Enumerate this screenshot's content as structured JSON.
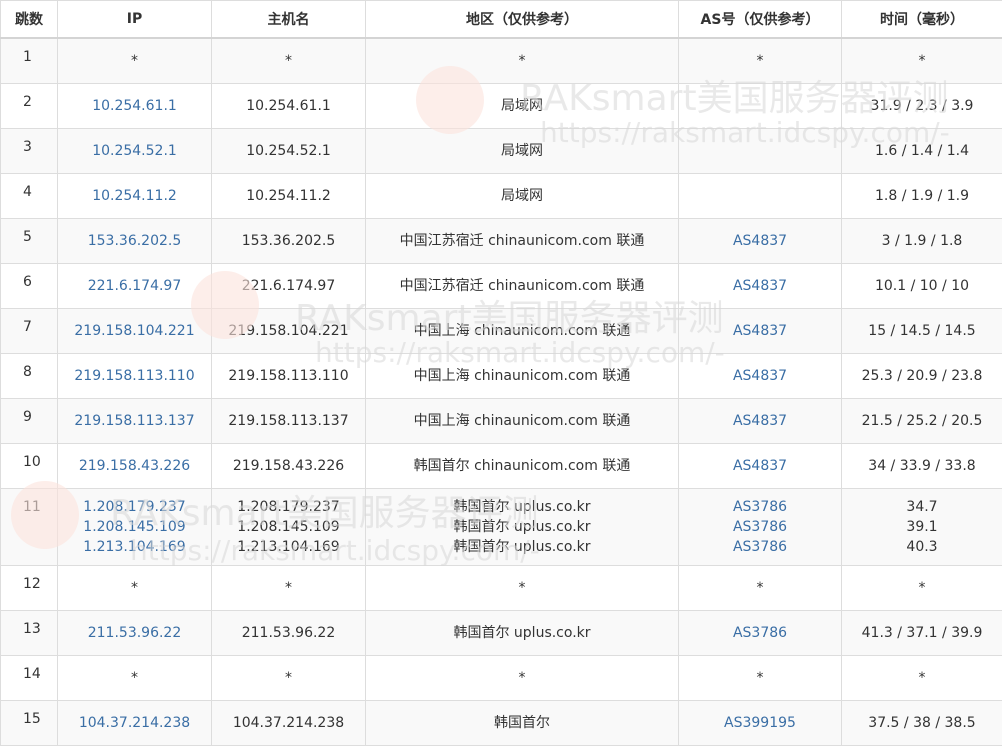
{
  "headers": {
    "hop": "跳数",
    "ip": "IP",
    "host": "主机名",
    "region": "地区（仅供参考）",
    "as": "AS号（仅供参考）",
    "time": "时间（毫秒）"
  },
  "rows": [
    {
      "hop": "1",
      "ip": "*",
      "host": "*",
      "region": "*",
      "as": "*",
      "time": "*"
    },
    {
      "hop": "2",
      "ip": "10.254.61.1",
      "host": "10.254.61.1",
      "region": "局域网",
      "as": "",
      "time": "31.9 / 2.3 / 3.9"
    },
    {
      "hop": "3",
      "ip": "10.254.52.1",
      "host": "10.254.52.1",
      "region": "局域网",
      "as": "",
      "time": "1.6 / 1.4 / 1.4"
    },
    {
      "hop": "4",
      "ip": "10.254.11.2",
      "host": "10.254.11.2",
      "region": "局域网",
      "as": "",
      "time": "1.8 / 1.9 / 1.9"
    },
    {
      "hop": "5",
      "ip": "153.36.202.5",
      "host": "153.36.202.5",
      "region": "中国江苏宿迁 chinaunicom.com 联通",
      "as": "AS4837",
      "time": "3 / 1.9 / 1.8"
    },
    {
      "hop": "6",
      "ip": "221.6.174.97",
      "host": "221.6.174.97",
      "region": "中国江苏宿迁 chinaunicom.com 联通",
      "as": "AS4837",
      "time": "10.1 / 10 / 10"
    },
    {
      "hop": "7",
      "ip": "219.158.104.221",
      "host": "219.158.104.221",
      "region": "中国上海 chinaunicom.com 联通",
      "as": "AS4837",
      "time": "15 / 14.5 / 14.5"
    },
    {
      "hop": "8",
      "ip": "219.158.113.110",
      "host": "219.158.113.110",
      "region": "中国上海 chinaunicom.com 联通",
      "as": "AS4837",
      "time": "25.3 / 20.9 / 23.8"
    },
    {
      "hop": "9",
      "ip": "219.158.113.137",
      "host": "219.158.113.137",
      "region": "中国上海 chinaunicom.com 联通",
      "as": "AS4837",
      "time": "21.5 / 25.2 / 20.5"
    },
    {
      "hop": "10",
      "ip": "219.158.43.226",
      "host": "219.158.43.226",
      "region": "韩国首尔 chinaunicom.com 联通",
      "as": "AS4837",
      "time": "34 / 33.9 / 33.8"
    },
    {
      "hop": "11",
      "multi": [
        {
          "ip": "1.208.179.237",
          "host": "1.208.179.237",
          "region": "韩国首尔 uplus.co.kr",
          "as": "AS3786",
          "time": "34.7"
        },
        {
          "ip": "1.208.145.109",
          "host": "1.208.145.109",
          "region": "韩国首尔 uplus.co.kr",
          "as": "AS3786",
          "time": "39.1"
        },
        {
          "ip": "1.213.104.169",
          "host": "1.213.104.169",
          "region": "韩国首尔 uplus.co.kr",
          "as": "AS3786",
          "time": "40.3"
        }
      ]
    },
    {
      "hop": "12",
      "ip": "*",
      "host": "*",
      "region": "*",
      "as": "*",
      "time": "*"
    },
    {
      "hop": "13",
      "ip": "211.53.96.22",
      "host": "211.53.96.22",
      "region": "韩国首尔 uplus.co.kr",
      "as": "AS3786",
      "time": "41.3 / 37.1 / 39.9"
    },
    {
      "hop": "14",
      "ip": "*",
      "host": "*",
      "region": "*",
      "as": "*",
      "time": "*"
    },
    {
      "hop": "15",
      "ip": "104.37.214.238",
      "host": "104.37.214.238",
      "region": "韩国首尔",
      "as": "AS399195",
      "time": "37.5 / 38 / 38.5"
    }
  ],
  "watermark": {
    "brand": "RAKsmart美国服务器评测",
    "url": "https://raksmart.idcspy.com/-"
  },
  "colors": {
    "link": "#3a6ea5",
    "border": "#dddddd",
    "stripe": "#f9f9f9"
  }
}
